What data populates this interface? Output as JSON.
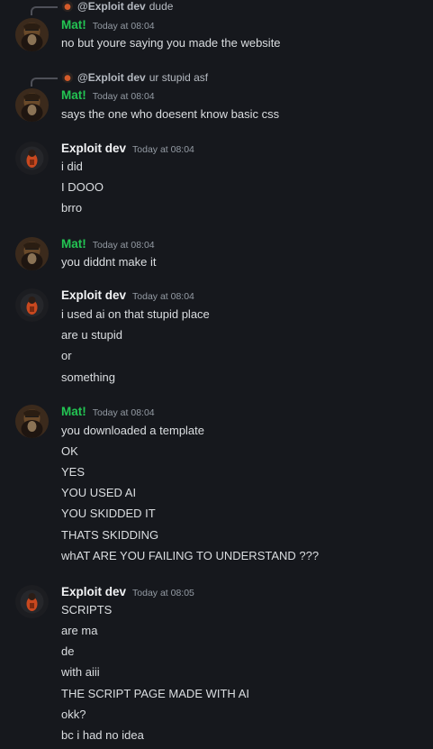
{
  "users": {
    "mat": "Mat!",
    "dev": "Exploit dev"
  },
  "replies": [
    {
      "name": "@Exploit dev",
      "text": "dude"
    },
    {
      "name": "@Exploit dev",
      "text": "ur stupid asf"
    }
  ],
  "messages": [
    {
      "author": "Mat!",
      "time": "Today at 08:04",
      "lines": [
        "no but youre saying you made the website"
      ]
    },
    {
      "author": "Mat!",
      "time": "Today at 08:04",
      "lines": [
        "says the one who doesent know basic css"
      ]
    },
    {
      "author": "Exploit dev",
      "time": "Today at 08:04",
      "lines": [
        "i did",
        "I DOOO",
        "brro"
      ]
    },
    {
      "author": "Mat!",
      "time": "Today at 08:04",
      "lines": [
        "you diddnt make it"
      ]
    },
    {
      "author": "Exploit dev",
      "time": "Today at 08:04",
      "lines": [
        "i used ai on that stupid place",
        "are u stupid",
        "or",
        "something"
      ]
    },
    {
      "author": "Mat!",
      "time": "Today at 08:04",
      "lines": [
        "you downloaded a template",
        "OK",
        "YES",
        "YOU USED AI",
        "YOU SKIDDED IT",
        "THATS SKIDDING",
        "whAT ARE YOU FAILING TO UNDERSTAND ???"
      ]
    },
    {
      "author": "Exploit dev",
      "time": "Today at 08:05",
      "lines": [
        "SCRIPTS",
        "are ma",
        "de",
        "with aiii",
        "THE SCRIPT PAGE MADE WITH AI",
        "okk?",
        "bc i had no idea"
      ]
    }
  ],
  "colors": {
    "background": "#16181d",
    "mat_name": "#23c553",
    "dev_name": "#f2f3f5",
    "text": "#dbdee1",
    "timestamp": "#949ba4"
  }
}
